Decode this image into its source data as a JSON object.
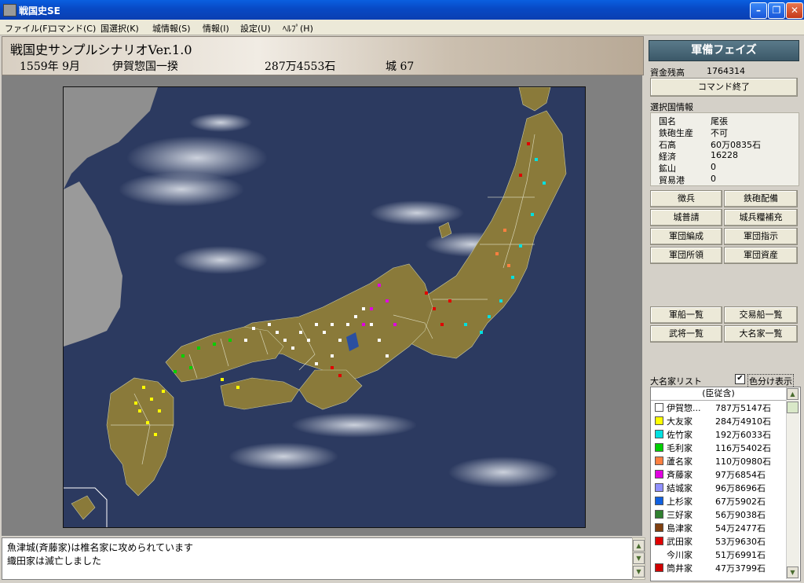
{
  "window": {
    "title": "戦国史SE"
  },
  "menu": [
    "ファイル(F)",
    "コマンド(C)",
    "国選択(K)",
    "城情報(S)",
    "情報(I)",
    "設定(U)",
    "ﾍﾙﾌﾟ(H)"
  ],
  "header": {
    "scenario": "戦国史サンプルシナリオVer.1.0",
    "date": "1559年 9月",
    "clan": "伊賀惣国一揆",
    "koku": "287万4553石",
    "castles": "城 67"
  },
  "panel": {
    "phase": "軍備フェイズ",
    "funds_label": "資金残高",
    "funds_value": "1764314",
    "end_command": "コマンド終了",
    "selected_label": "選択国情報",
    "info": [
      {
        "k": "国名",
        "v": "尾張"
      },
      {
        "k": "鉄砲生産",
        "v": "不可"
      },
      {
        "k": "石高",
        "v": "60万0835石"
      },
      {
        "k": "経済",
        "v": "16228"
      },
      {
        "k": "鉱山",
        "v": "0"
      },
      {
        "k": "貿易港",
        "v": "0"
      }
    ],
    "buttons": [
      "徴兵",
      "鉄砲配備",
      "城普請",
      "城兵糧補充",
      "軍団編成",
      "軍団指示",
      "軍団所領",
      "軍団資産",
      "軍船一覧",
      "交易船一覧",
      "武将一覧",
      "大名家一覧"
    ],
    "daimyo_title": "大名家リスト",
    "color_toggle": "色分け表示",
    "list_header": "(臣従含)",
    "daimyo": [
      {
        "name": "伊賀惣...",
        "koku": "787万5147石",
        "color": "#ffffff"
      },
      {
        "name": "大友家",
        "koku": "284万4910石",
        "color": "#ffff00"
      },
      {
        "name": "佐竹家",
        "koku": "192万6033石",
        "color": "#00e0e0"
      },
      {
        "name": "毛利家",
        "koku": "116万5402石",
        "color": "#00d000"
      },
      {
        "name": "蘆名家",
        "koku": "110万0980石",
        "color": "#ff8040"
      },
      {
        "name": "斉藤家",
        "koku": "97万6854石",
        "color": "#e000e0"
      },
      {
        "name": "結城家",
        "koku": "96万8696石",
        "color": "#9090ff"
      },
      {
        "name": "上杉家",
        "koku": "67万5902石",
        "color": "#1060e0"
      },
      {
        "name": "三好家",
        "koku": "56万9038石",
        "color": "#308030"
      },
      {
        "name": "島津家",
        "koku": "54万2477石",
        "color": "#804010"
      },
      {
        "name": "武田家",
        "koku": "53万9630石",
        "color": "#e00000"
      },
      {
        "name": "今川家",
        "koku": "51万6991石",
        "color": ""
      },
      {
        "name": "筒井家",
        "koku": "47万3799石",
        "color": "#d00000"
      }
    ]
  },
  "log": [
    "魚津城(斉藤家)は椎名家に攻められています",
    "織田家は滅亡しました"
  ]
}
